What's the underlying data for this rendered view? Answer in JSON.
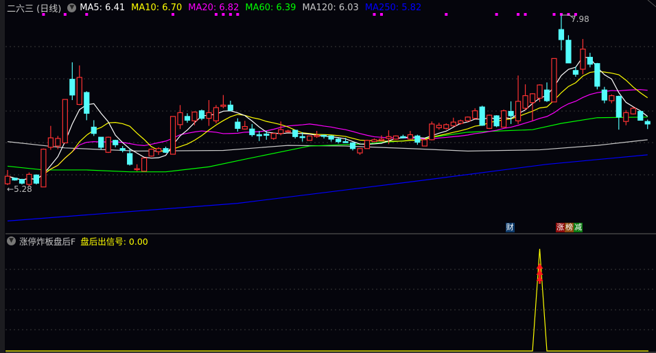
{
  "header": {
    "title": "二六三 (日线)",
    "menu_icon": "chevron-down-circle-icon",
    "ma": [
      {
        "label": "MA5: 6.41",
        "color": "#ffffff"
      },
      {
        "label": "MA10: 6.70",
        "color": "#ffff00"
      },
      {
        "label": "MA20: 6.82",
        "color": "#ff00ff"
      },
      {
        "label": "MA60: 6.39",
        "color": "#00ff00"
      },
      {
        "label": "MA120: 6.03",
        "color": "#c8c8c8"
      },
      {
        "label": "MA250: 5.82",
        "color": "#0000ff"
      }
    ]
  },
  "price_labels": {
    "max": "7.98",
    "min": "5.28"
  },
  "event_tags": {
    "finance": "财",
    "tags": [
      {
        "text": "涨",
        "color": "#8b0a0a"
      },
      {
        "text": "榜",
        "color": "#8a4a10"
      },
      {
        "text": "减",
        "color": "#0c7a12"
      }
    ]
  },
  "indicator": {
    "name": "涨停炸板盘后F",
    "signal_label": "盘后出信号: 0.00",
    "signal_color": "#ffff00"
  },
  "colors": {
    "up": "#ff3232",
    "down": "#54fcfc",
    "background": "#05050c",
    "marker": "#ff00ff"
  },
  "chart_data": {
    "type": "candlestick",
    "price_range": [
      5.28,
      7.98
    ],
    "candles_ohlc": [
      [
        5.3,
        5.42,
        5.52,
        5.28
      ],
      [
        5.39,
        5.36,
        5.4,
        5.35
      ],
      [
        5.37,
        5.31,
        5.38,
        5.29
      ],
      [
        5.29,
        5.45,
        5.48,
        5.27
      ],
      [
        5.44,
        5.31,
        5.45,
        5.29
      ],
      [
        5.25,
        5.85,
        5.86,
        5.25
      ],
      [
        5.88,
        6.03,
        6.22,
        5.84
      ],
      [
        5.9,
        6.02,
        6.06,
        5.85
      ],
      [
        5.95,
        6.64,
        6.64,
        5.95
      ],
      [
        6.96,
        6.71,
        7.23,
        6.63
      ],
      [
        6.56,
        6.99,
        7.18,
        6.55
      ],
      [
        6.75,
        6.42,
        6.77,
        6.31
      ],
      [
        6.2,
        6.1,
        6.31,
        6.06
      ],
      [
        6.04,
        5.88,
        6.04,
        5.84
      ],
      [
        5.8,
        6.04,
        6.05,
        5.79
      ],
      [
        5.99,
        5.92,
        6.0,
        5.88
      ],
      [
        5.86,
        5.83,
        5.9,
        5.8
      ],
      [
        5.78,
        5.61,
        5.85,
        5.59
      ],
      [
        5.54,
        5.54,
        5.61,
        5.5
      ],
      [
        5.5,
        5.71,
        5.71,
        5.5
      ],
      [
        5.74,
        5.85,
        5.86,
        5.73
      ],
      [
        5.81,
        5.86,
        5.88,
        5.76
      ],
      [
        5.86,
        5.8,
        5.89,
        5.79
      ],
      [
        5.77,
        6.37,
        6.37,
        5.77
      ],
      [
        6.24,
        6.43,
        6.55,
        6.17
      ],
      [
        6.37,
        6.31,
        6.42,
        6.27
      ],
      [
        6.3,
        6.44,
        6.45,
        6.23
      ],
      [
        6.46,
        6.34,
        6.48,
        6.31
      ],
      [
        6.34,
        6.43,
        6.63,
        6.22
      ],
      [
        6.3,
        6.51,
        6.55,
        6.26
      ],
      [
        6.53,
        6.55,
        6.71,
        6.5
      ],
      [
        6.55,
        6.47,
        6.62,
        6.45
      ],
      [
        6.28,
        6.18,
        6.34,
        6.13
      ],
      [
        6.17,
        6.21,
        6.3,
        6.16
      ],
      [
        6.17,
        6.08,
        6.25,
        6.05
      ],
      [
        6.08,
        6.07,
        6.14,
        5.98
      ],
      [
        6.09,
        6.07,
        6.14,
        6.0
      ],
      [
        6.02,
        6.1,
        6.11,
        6.0
      ],
      [
        6.1,
        6.16,
        6.29,
        6.07
      ],
      [
        6.13,
        6.14,
        6.16,
        6.12
      ],
      [
        6.15,
        6.05,
        6.16,
        6.02
      ],
      [
        6.05,
        6.04,
        6.12,
        5.97
      ],
      [
        5.99,
        6.06,
        6.06,
        5.99
      ],
      [
        6.05,
        6.07,
        6.14,
        6.03
      ],
      [
        6.07,
        6.06,
        6.08,
        6.02
      ],
      [
        6.06,
        6.01,
        6.07,
        5.97
      ],
      [
        6.01,
        5.97,
        6.03,
        5.94
      ],
      [
        5.97,
        5.96,
        6.03,
        5.95
      ],
      [
        5.95,
        5.86,
        5.96,
        5.83
      ],
      [
        5.79,
        5.86,
        5.86,
        5.76
      ],
      [
        5.86,
        5.99,
        6.0,
        5.86
      ],
      [
        5.97,
        6.0,
        6.02,
        5.96
      ],
      [
        5.99,
        6.01,
        6.07,
        5.98
      ],
      [
        6.02,
        6.05,
        6.15,
        5.93
      ],
      [
        6.01,
        6.06,
        6.07,
        6.0
      ],
      [
        6.05,
        6.03,
        6.08,
        6.02
      ],
      [
        6.01,
        6.08,
        6.14,
        6.0
      ],
      [
        6.06,
        5.96,
        6.08,
        5.92
      ],
      [
        5.9,
        6.0,
        6.01,
        5.9
      ],
      [
        6.0,
        6.25,
        6.29,
        5.99
      ],
      [
        6.19,
        6.23,
        6.27,
        6.16
      ],
      [
        6.18,
        6.24,
        6.26,
        6.16
      ],
      [
        6.22,
        6.28,
        6.35,
        6.21
      ],
      [
        6.26,
        6.3,
        6.32,
        6.24
      ],
      [
        6.3,
        6.36,
        6.37,
        6.28
      ],
      [
        6.34,
        6.46,
        6.5,
        6.33
      ],
      [
        6.52,
        6.23,
        6.54,
        6.22
      ],
      [
        6.18,
        6.39,
        6.4,
        6.17
      ],
      [
        6.38,
        6.22,
        6.39,
        6.2
      ],
      [
        6.2,
        6.46,
        6.48,
        6.2
      ],
      [
        6.45,
        6.38,
        6.61,
        6.25
      ],
      [
        6.3,
        6.61,
        7.02,
        6.25
      ],
      [
        6.5,
        6.7,
        6.88,
        6.47
      ],
      [
        6.59,
        6.73,
        6.74,
        6.3
      ],
      [
        6.66,
        6.87,
        6.88,
        6.6
      ],
      [
        6.79,
        6.62,
        6.91,
        6.6
      ],
      [
        6.6,
        7.29,
        7.29,
        6.6
      ],
      [
        7.75,
        7.59,
        7.98,
        7.42
      ],
      [
        7.58,
        7.22,
        7.66,
        7.22
      ],
      [
        7.1,
        7.04,
        7.16,
        7.0
      ],
      [
        7.12,
        7.44,
        7.6,
        7.04
      ],
      [
        7.31,
        7.2,
        7.38,
        7.15
      ],
      [
        7.21,
        6.85,
        7.22,
        6.8
      ],
      [
        6.79,
        6.63,
        6.84,
        6.58
      ],
      [
        6.62,
        6.7,
        6.72,
        6.58
      ],
      [
        6.69,
        6.36,
        6.7,
        6.16
      ],
      [
        6.29,
        6.43,
        6.47,
        6.23
      ],
      [
        6.41,
        6.5,
        6.52,
        6.4
      ],
      [
        6.45,
        6.31,
        6.46,
        6.31
      ],
      [
        6.29,
        6.25,
        6.32,
        6.17
      ]
    ],
    "ma60_points": [
      [
        0,
        5.58
      ],
      [
        5,
        5.52
      ],
      [
        11,
        5.52
      ],
      [
        17,
        5.49
      ],
      [
        22,
        5.49
      ],
      [
        28,
        5.57
      ],
      [
        33,
        5.69
      ],
      [
        42,
        5.9
      ],
      [
        49,
        5.93
      ],
      [
        56,
        5.99
      ],
      [
        64,
        6.12
      ],
      [
        73,
        6.16
      ],
      [
        77,
        6.26
      ],
      [
        82,
        6.35
      ],
      [
        89,
        6.36
      ]
    ],
    "ma120_points": [
      [
        0,
        5.97
      ],
      [
        8,
        5.87
      ],
      [
        18,
        5.82
      ],
      [
        30,
        5.83
      ],
      [
        39,
        5.91
      ],
      [
        47,
        5.9
      ],
      [
        56,
        5.86
      ],
      [
        64,
        5.82
      ],
      [
        74,
        5.84
      ],
      [
        82,
        5.91
      ],
      [
        89,
        6.0
      ]
    ],
    "ma250_points": [
      [
        0,
        4.71
      ],
      [
        32,
        4.99
      ],
      [
        56,
        5.33
      ],
      [
        75,
        5.61
      ],
      [
        89,
        5.76
      ]
    ],
    "marker_indices": [
      5,
      8,
      11,
      23,
      29,
      30,
      31,
      32,
      51,
      52,
      61,
      68,
      71,
      72,
      76,
      77,
      78,
      79
    ],
    "max_index": 77,
    "finance_tag_index": 68,
    "event_tag_index": 75,
    "signal_index": 74,
    "signal_value": 1
  }
}
